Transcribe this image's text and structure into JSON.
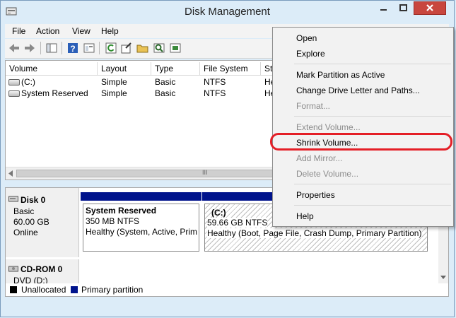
{
  "window": {
    "title": "Disk Management"
  },
  "menubar": {
    "items": [
      "File",
      "Action",
      "View",
      "Help"
    ]
  },
  "toolbar": {
    "icons": [
      "back-arrow-icon",
      "forward-arrow-icon",
      "console-tree-icon",
      "help-icon",
      "properties-icon",
      "refresh-icon",
      "export-icon",
      "open-folder-icon",
      "search-disk-icon",
      "settings-icon"
    ]
  },
  "volume_list": {
    "columns": [
      "Volume",
      "Layout",
      "Type",
      "File System",
      "St"
    ],
    "rows": [
      {
        "volume": "(C:)",
        "layout": "Simple",
        "type": "Basic",
        "fs": "NTFS",
        "status": "He"
      },
      {
        "volume": "System Reserved",
        "layout": "Simple",
        "type": "Basic",
        "fs": "NTFS",
        "status": "He"
      }
    ],
    "scroll_marker": "III"
  },
  "disks": [
    {
      "name": "Disk 0",
      "type": "Basic",
      "size": "60.00 GB",
      "status": "Online",
      "partitions": [
        {
          "name": "System Reserved",
          "size": "350 MB NTFS",
          "health": "Healthy (System, Active, Prim"
        },
        {
          "name": "(C:)",
          "size": "59.66 GB NTFS",
          "health": "Healthy (Boot, Page File, Crash Dump, Primary Partition)"
        }
      ]
    },
    {
      "name": "CD-ROM 0",
      "type": "DVD (D:)"
    }
  ],
  "legend": [
    {
      "label": "Unallocated",
      "color": "#000000"
    },
    {
      "label": "Primary partition",
      "color": "#00138c"
    }
  ],
  "context_menu": {
    "items": [
      {
        "label": "Open",
        "enabled": true
      },
      {
        "label": "Explore",
        "enabled": true
      },
      {
        "label": "Mark Partition as Active",
        "enabled": true
      },
      {
        "label": "Change Drive Letter and Paths...",
        "enabled": true
      },
      {
        "label": "Format...",
        "enabled": false
      },
      {
        "label": "Extend Volume...",
        "enabled": false
      },
      {
        "label": "Shrink Volume...",
        "enabled": true,
        "highlighted": true
      },
      {
        "label": "Add Mirror...",
        "enabled": false
      },
      {
        "label": "Delete Volume...",
        "enabled": false
      },
      {
        "label": "Properties",
        "enabled": true
      },
      {
        "label": "Help",
        "enabled": true
      }
    ]
  },
  "colors": {
    "highlight_ring": "#e41e26",
    "primary_partition": "#00138c",
    "window_frame": "#dcecf8"
  }
}
